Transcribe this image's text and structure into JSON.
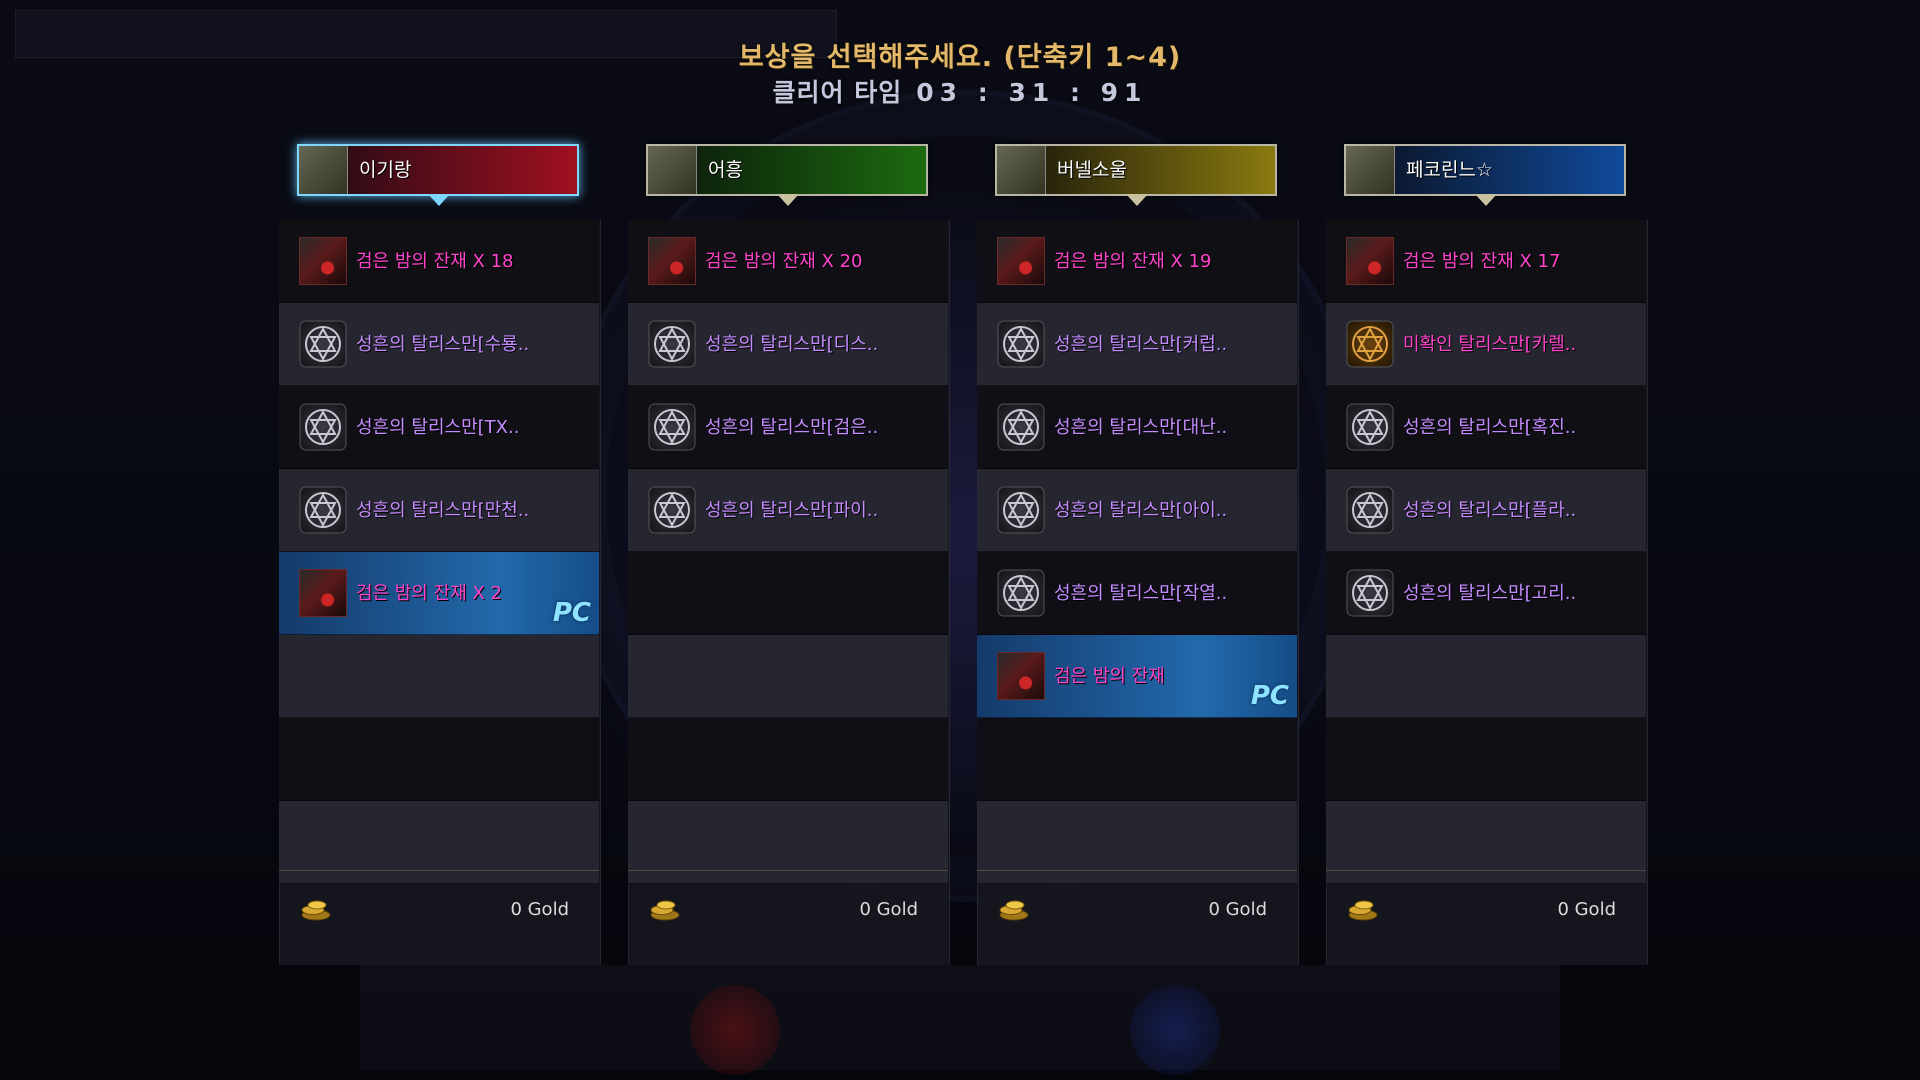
{
  "header": {
    "title": "보상을 선택해주세요. (단축키 1~4)",
    "clear_label": "클리어 타임",
    "clear_time": "03 : 31 : 91"
  },
  "colors": {
    "magenta_text": "#ff44cc",
    "purple_text": "#c58cff",
    "pc_tag": "#8ee4ff",
    "title_gold": "#e3b86a"
  },
  "columns": [
    {
      "name": "이기랑",
      "plate_gradient": [
        "#1a0a14",
        "#a01020"
      ],
      "selected": true,
      "rows": [
        {
          "icon": "remnant-icon",
          "text": "검은 밤의 잔재 X 18",
          "color": "magenta"
        },
        {
          "icon": "talisman-icon",
          "text": "성흔의 탈리스만[수룡..",
          "color": "purple"
        },
        {
          "icon": "talisman-icon",
          "text": "성흔의 탈리스만[TX..",
          "color": "purple"
        },
        {
          "icon": "talisman-icon",
          "text": "성흔의 탈리스만[만천..",
          "color": "purple"
        },
        {
          "icon": "remnant-icon",
          "text": "검은 밤의 잔재 X 2",
          "color": "magenta",
          "pc": "PC"
        },
        {},
        {},
        {}
      ],
      "gold": "0 Gold"
    },
    {
      "name": "어흥",
      "plate_gradient": [
        "#0a140a",
        "#1c6a10"
      ],
      "selected": false,
      "rows": [
        {
          "icon": "remnant-icon",
          "text": "검은 밤의 잔재 X 20",
          "color": "magenta"
        },
        {
          "icon": "talisman-icon",
          "text": "성흔의 탈리스만[디스..",
          "color": "purple"
        },
        {
          "icon": "talisman-icon",
          "text": "성흔의 탈리스만[검은..",
          "color": "purple"
        },
        {
          "icon": "talisman-icon",
          "text": "성흔의 탈리스만[파이..",
          "color": "purple"
        },
        {},
        {},
        {},
        {}
      ],
      "gold": "0 Gold"
    },
    {
      "name": "버넬소울",
      "plate_gradient": [
        "#14120a",
        "#8a7a10"
      ],
      "selected": false,
      "rows": [
        {
          "icon": "remnant-icon",
          "text": "검은 밤의 잔재 X 19",
          "color": "magenta"
        },
        {
          "icon": "talisman-icon",
          "text": "성흔의 탈리스만[커럽..",
          "color": "purple"
        },
        {
          "icon": "talisman-icon",
          "text": "성흔의 탈리스만[대난..",
          "color": "purple"
        },
        {
          "icon": "talisman-icon",
          "text": "성흔의 탈리스만[아이..",
          "color": "purple"
        },
        {
          "icon": "talisman-icon",
          "text": "성흔의 탈리스만[작열..",
          "color": "purple"
        },
        {
          "icon": "remnant-icon",
          "text": "검은 밤의 잔재",
          "color": "magenta",
          "pc": "PC"
        },
        {},
        {}
      ],
      "gold": "0 Gold"
    },
    {
      "name": "페코린느☆",
      "plate_gradient": [
        "#0a0e1a",
        "#104a9a"
      ],
      "selected": false,
      "rows": [
        {
          "icon": "remnant-icon",
          "text": "검은 밤의 잔재 X 17",
          "color": "magenta"
        },
        {
          "icon": "talisman-gold-icon",
          "text": "미확인 탈리스만[카렐..",
          "color": "magenta"
        },
        {
          "icon": "talisman-icon",
          "text": "성흔의 탈리스만[혹진..",
          "color": "purple"
        },
        {
          "icon": "talisman-icon",
          "text": "성흔의 탈리스만[플라..",
          "color": "purple"
        },
        {
          "icon": "talisman-icon",
          "text": "성흔의 탈리스만[고리..",
          "color": "purple"
        },
        {},
        {},
        {}
      ],
      "gold": "0 Gold"
    }
  ]
}
